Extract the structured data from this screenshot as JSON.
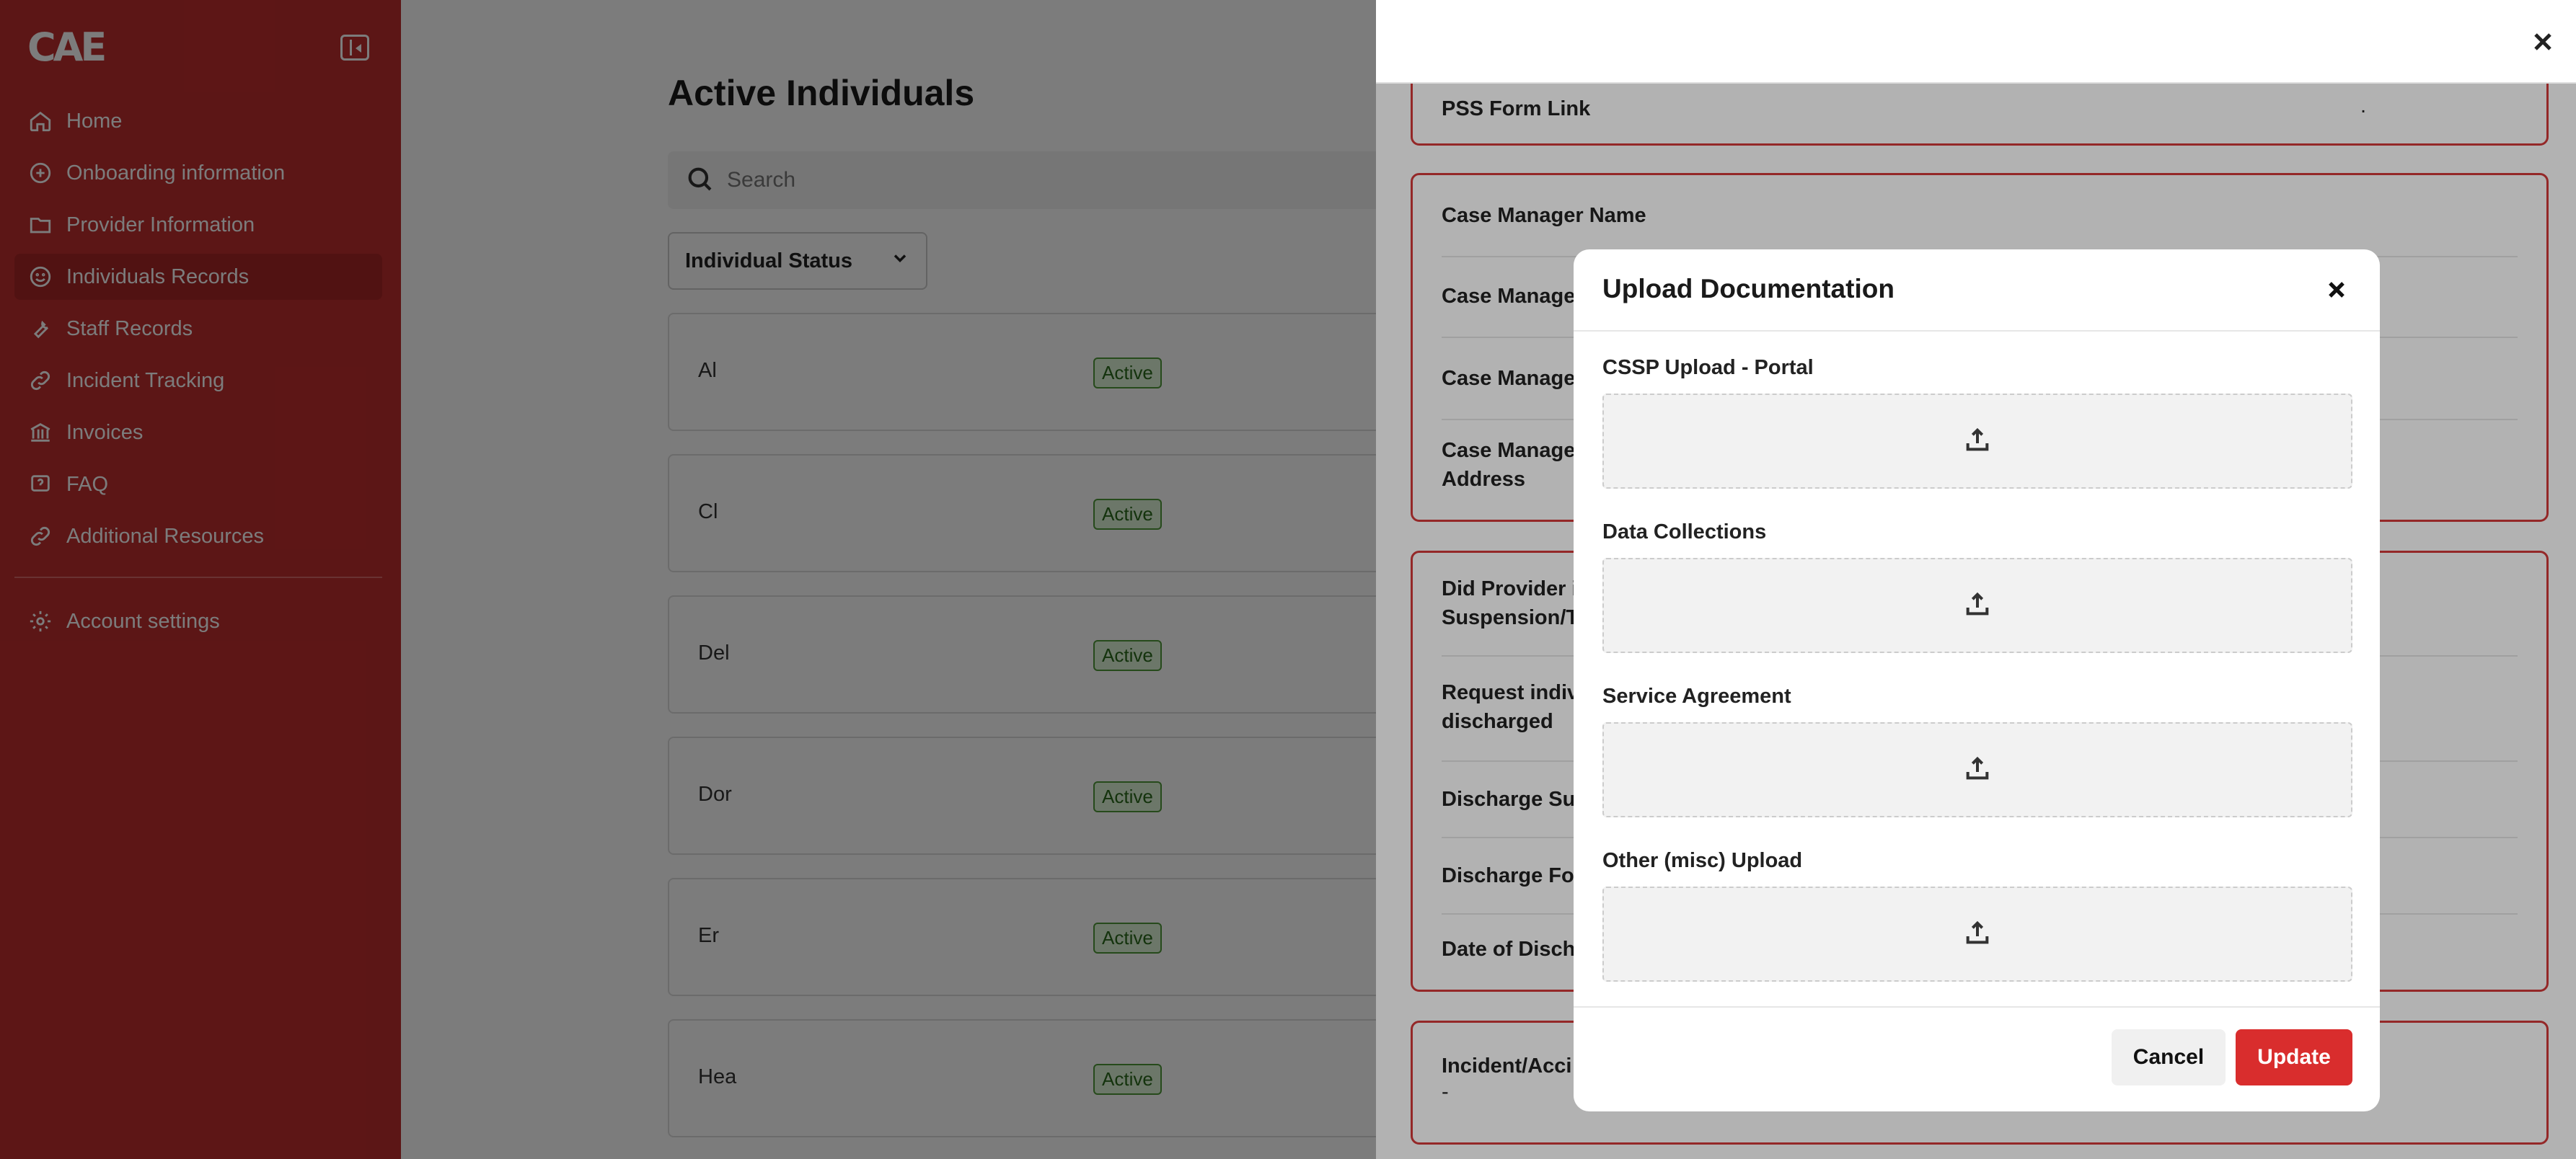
{
  "brand": {
    "logo_text": "CAE",
    "accent": "#bf2e2e"
  },
  "sidebar": {
    "items": [
      {
        "label": "Home",
        "icon": "home-icon"
      },
      {
        "label": "Onboarding information",
        "icon": "plus-circle-icon"
      },
      {
        "label": "Provider Information",
        "icon": "folder-icon"
      },
      {
        "label": "Individuals Records",
        "icon": "smile-icon",
        "active": true
      },
      {
        "label": "Staff Records",
        "icon": "wrench-icon"
      },
      {
        "label": "Incident Tracking",
        "icon": "link-icon"
      },
      {
        "label": "Invoices",
        "icon": "bank-icon"
      },
      {
        "label": "FAQ",
        "icon": "question-icon"
      },
      {
        "label": "Additional Resources",
        "icon": "link-icon"
      }
    ],
    "account": {
      "label": "Account settings",
      "icon": "gear-icon"
    }
  },
  "main": {
    "title": "Active Individuals",
    "search_placeholder": "Search",
    "status_filter": "Individual Status",
    "individuals": [
      {
        "name": "Al",
        "status": "Active"
      },
      {
        "name": "Cl",
        "status": "Active"
      },
      {
        "name": "Del",
        "status": "Active"
      },
      {
        "name": "Dor",
        "status": "Active"
      },
      {
        "name": "Er",
        "status": "Active"
      },
      {
        "name": "Hea",
        "status": "Active"
      }
    ]
  },
  "panel": {
    "pss_label": "PSS Form Link",
    "pss_value": ".",
    "case_manager": [
      "Case Manager Name",
      "Case Manage",
      "Case Manage",
      "Case Manage"
    ],
    "case_manager_address_suffix": "Address",
    "discharge": [
      {
        "label": "Did Provider i",
        "sub": "Suspension/T"
      },
      {
        "label": "Request indiv",
        "sub": "discharged"
      },
      {
        "label": "Discharge Su"
      },
      {
        "label": "Discharge For"
      },
      {
        "label": "Date of Disch"
      }
    ],
    "incident_label": "Incident/Acci",
    "incident_value": "-"
  },
  "modal": {
    "title": "Upload Documentation",
    "fields": [
      "CSSP Upload - Portal",
      "Data Collections",
      "Service Agreement",
      "Other (misc) Upload"
    ],
    "cancel_label": "Cancel",
    "update_label": "Update"
  }
}
